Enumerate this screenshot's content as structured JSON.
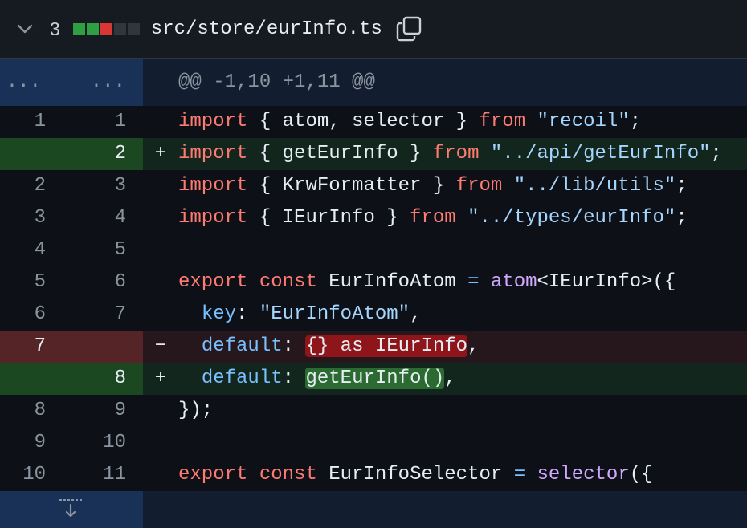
{
  "file": {
    "change_count": "3",
    "path": "src/store/eurInfo.ts",
    "diffstat": [
      "#2ea043",
      "#2ea043",
      "#da3633",
      "#30363d",
      "#30363d"
    ]
  },
  "hunk": {
    "left": "...",
    "right": "...",
    "header": "@@ -1,10 +1,11 @@"
  },
  "lines": [
    {
      "type": "ctx",
      "old": "1",
      "new": "1",
      "sign": "",
      "tokens": [
        [
          "kw",
          "import"
        ],
        [
          "",
          "{ atom, selector } "
        ],
        [
          "kw",
          "from"
        ],
        [
          "",
          ""
        ],
        [
          "str",
          "\"recoil\""
        ],
        [
          "",
          ";"
        ]
      ]
    },
    {
      "type": "add",
      "old": "",
      "new": "2",
      "sign": "+",
      "tokens": [
        [
          "kw",
          "import"
        ],
        [
          "",
          "{ getEurInfo } "
        ],
        [
          "kw",
          "from"
        ],
        [
          "",
          ""
        ],
        [
          "str",
          "\"../api/getEurInfo\""
        ],
        [
          "",
          ";"
        ]
      ]
    },
    {
      "type": "ctx",
      "old": "2",
      "new": "3",
      "sign": "",
      "tokens": [
        [
          "kw",
          "import"
        ],
        [
          "",
          "{ KrwFormatter } "
        ],
        [
          "kw",
          "from"
        ],
        [
          "",
          ""
        ],
        [
          "str",
          "\"../lib/utils\""
        ],
        [
          "",
          ";"
        ]
      ]
    },
    {
      "type": "ctx",
      "old": "3",
      "new": "4",
      "sign": "",
      "tokens": [
        [
          "kw",
          "import"
        ],
        [
          "",
          "{ IEurInfo } "
        ],
        [
          "kw",
          "from"
        ],
        [
          "",
          ""
        ],
        [
          "str",
          "\"../types/eurInfo\""
        ],
        [
          "",
          ";"
        ]
      ]
    },
    {
      "type": "ctx",
      "old": "4",
      "new": "5",
      "sign": "",
      "tokens": []
    },
    {
      "type": "ctx",
      "old": "5",
      "new": "6",
      "sign": "",
      "tokens": [
        [
          "kw",
          "export"
        ],
        [
          "kw",
          "const"
        ],
        [
          "",
          "EurInfoAtom "
        ],
        [
          "op",
          "="
        ],
        [
          "fn",
          "atom"
        ],
        [
          "",
          "<IEurInfo>({"
        ]
      ]
    },
    {
      "type": "ctx",
      "old": "6",
      "new": "7",
      "sign": "",
      "tokens": [
        [
          "",
          "  "
        ],
        [
          "prop",
          "key"
        ],
        [
          "",
          ": "
        ],
        [
          "str",
          "\"EurInfoAtom\""
        ],
        [
          "",
          ","
        ]
      ]
    },
    {
      "type": "del",
      "old": "7",
      "new": "",
      "sign": "−",
      "tokens": [
        [
          "",
          "  "
        ],
        [
          "prop",
          "default"
        ],
        [
          "",
          ": "
        ],
        [
          "hl-del",
          "{} as IEurInfo"
        ],
        [
          "",
          ","
        ]
      ]
    },
    {
      "type": "add",
      "old": "",
      "new": "8",
      "sign": "+",
      "tokens": [
        [
          "",
          "  "
        ],
        [
          "prop",
          "default"
        ],
        [
          "",
          ": "
        ],
        [
          "hl-add",
          "getEurInfo()"
        ],
        [
          "",
          ","
        ]
      ]
    },
    {
      "type": "ctx",
      "old": "8",
      "new": "9",
      "sign": "",
      "tokens": [
        [
          "",
          "});"
        ]
      ]
    },
    {
      "type": "ctx",
      "old": "9",
      "new": "10",
      "sign": "",
      "tokens": []
    },
    {
      "type": "ctx",
      "old": "10",
      "new": "11",
      "sign": "",
      "tokens": [
        [
          "kw",
          "export"
        ],
        [
          "kw",
          "const"
        ],
        [
          "",
          "EurInfoSelector "
        ],
        [
          "op",
          "="
        ],
        [
          "fn",
          "selector"
        ],
        [
          "",
          "({"
        ]
      ]
    }
  ]
}
